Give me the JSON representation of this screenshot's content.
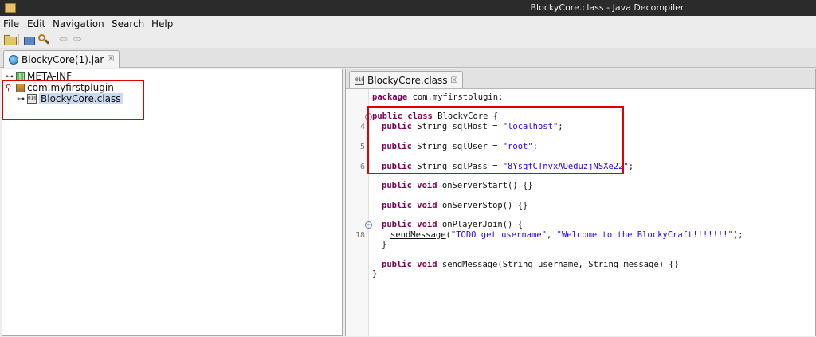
{
  "window": {
    "title": "BlockyCore.class - Java Decompiler"
  },
  "menu": [
    "File",
    "Edit",
    "Navigation",
    "Search",
    "Help"
  ],
  "file_tab": {
    "label": "BlockyCore(1).jar",
    "close": "☒"
  },
  "tree": {
    "meta_inf": "META-INF",
    "package": "com.myfirstplugin",
    "class_file": "BlockyCore.class",
    "class_icon_text": "010"
  },
  "editor_tab": {
    "label": "BlockyCore.class",
    "close": "☒"
  },
  "code": {
    "package_kw": "package",
    "package_name": " com.myfirstplugin;",
    "class_kw": "public class",
    "class_name": " BlockyCore {",
    "public_string": "public",
    "type_string": " String ",
    "sqlhost_decl": "sqlHost = ",
    "sqlhost_val": "\"localhost\"",
    "sqluser_decl": "sqlUser = ",
    "sqluser_val": "\"root\"",
    "sqlpass_decl": "sqlPass = ",
    "sqlpass_val": "\"8YsqfCTnvxAUeduzjNSXe22\"",
    "public_void": "public void",
    "start_sig": " onServerStart() {}",
    "stop_sig": " onServerStop() {}",
    "join_sig": " onPlayerJoin() {",
    "send_call": "sendMessage",
    "send_arg1": "\"TODO get username\"",
    "send_arg2": "\"Welcome to the BlockyCraft!!!!!!!\"",
    "send_sig": " sendMessage(String username, String message) {}",
    "close_brace": "}",
    "semicolon": ";",
    "open_paren": "(",
    "comma": ", ",
    "close_paren_semi": ");"
  },
  "line_numbers": {
    "l4": "4",
    "l5": "5",
    "l6": "6",
    "l18": "18"
  }
}
